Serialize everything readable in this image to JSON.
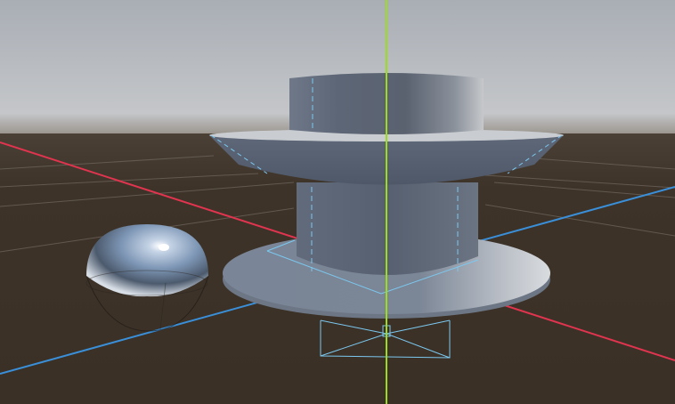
{
  "viewport": {
    "label": "",
    "background": {
      "sky_top": "#aeb2b8",
      "sky_horizon": "#c2c4c7",
      "ground": "#3b3127"
    },
    "axes": {
      "x_axis_color": "#e0344f",
      "y_axis_color": "#9bdc1c",
      "z_axis_color": "#3a8fd8"
    },
    "grid": {
      "visible": true,
      "color": "#6a6158"
    },
    "objects": [
      {
        "name": "glass-sphere",
        "material": "reflective-glass"
      },
      {
        "name": "stacked-cylinders",
        "material": "grey-metal",
        "parts": [
          "top-cylinder",
          "cone-flange",
          "middle-cylinder",
          "base-disc"
        ]
      }
    ],
    "selection_outline_color": "#7cc8f0"
  }
}
